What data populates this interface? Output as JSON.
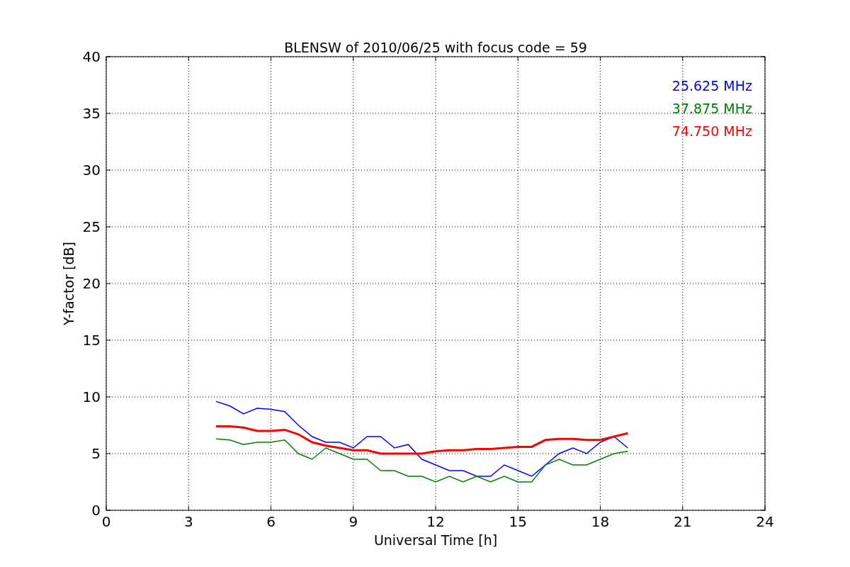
{
  "chart_data": {
    "type": "line",
    "title": "BLENSW of 2010/06/25 with focus code = 59",
    "xlabel": "Universal Time [h]",
    "ylabel": "Y-factor [dB]",
    "x": [
      4,
      4.5,
      5,
      5.5,
      6,
      6.5,
      7,
      7.5,
      8,
      8.5,
      9,
      9.5,
      10,
      10.5,
      11,
      11.5,
      12,
      12.5,
      13,
      13.5,
      14,
      14.5,
      15,
      15.5,
      16,
      16.5,
      17,
      17.5,
      18,
      18.5,
      19
    ],
    "series": [
      {
        "name": "25.625 MHz",
        "color": "#0000ff",
        "values": [
          9.6,
          9.2,
          8.5,
          9.0,
          8.9,
          8.7,
          7.5,
          6.5,
          6.0,
          6.0,
          5.5,
          6.5,
          6.5,
          5.5,
          5.8,
          4.5,
          4.0,
          3.5,
          3.5,
          3.0,
          3.0,
          4.0,
          3.5,
          3.0,
          4.0,
          5.0,
          5.5,
          5.0,
          6.0,
          6.5,
          5.5
        ]
      },
      {
        "name": "37.875 MHz",
        "color": "#008000",
        "values": [
          6.3,
          6.2,
          5.8,
          6.0,
          6.0,
          6.2,
          5.0,
          4.5,
          5.5,
          5.0,
          4.5,
          4.5,
          3.5,
          3.5,
          3.0,
          3.0,
          2.5,
          3.0,
          2.5,
          3.0,
          2.5,
          3.0,
          2.5,
          2.5,
          4.0,
          4.5,
          4.0,
          4.0,
          4.5,
          5.0,
          5.2
        ]
      },
      {
        "name": "74.750 MHz",
        "color": "#ff0000",
        "values": [
          7.4,
          7.4,
          7.3,
          7.0,
          7.0,
          7.1,
          6.7,
          6.0,
          5.7,
          5.5,
          5.3,
          5.3,
          5.0,
          5.0,
          5.0,
          5.0,
          5.2,
          5.3,
          5.3,
          5.4,
          5.4,
          5.5,
          5.6,
          5.6,
          6.2,
          6.3,
          6.3,
          6.2,
          6.2,
          6.5,
          6.8
        ]
      }
    ],
    "xlim": [
      0,
      24
    ],
    "ylim": [
      0,
      40
    ],
    "xticks": [
      0,
      3,
      6,
      9,
      12,
      15,
      18,
      21,
      24
    ],
    "yticks": [
      0,
      5,
      10,
      15,
      20,
      25,
      30,
      35,
      40
    ],
    "grid": true
  }
}
